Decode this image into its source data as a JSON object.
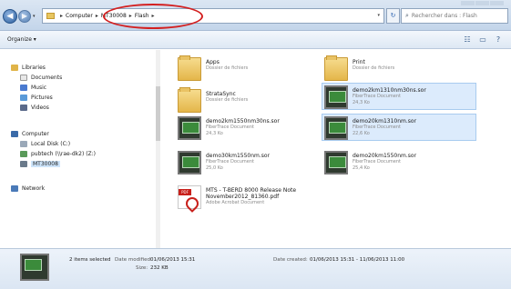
{
  "window": {
    "back_glyph": "◀",
    "forward_glyph": "▶"
  },
  "address_bar": {
    "crumbs": [
      "Computer",
      "MT30008",
      "Flash"
    ],
    "separator": "▸",
    "dropdown_glyph": "▾"
  },
  "refresh_glyph": "↻",
  "search": {
    "placeholder": "Rechercher dans : Flash",
    "icon": "magnifier-icon"
  },
  "toolbar": {
    "organize_label": "Organize ▾",
    "icons": [
      "view-options-icon",
      "preview-pane-icon",
      "help-icon"
    ]
  },
  "nav": {
    "items": [
      {
        "label": "Libraries",
        "icon": "libraries-icon",
        "color": "#e0b448"
      },
      {
        "label": "Documents",
        "icon": "documents-icon",
        "color": "#e8e8e8"
      },
      {
        "label": "Music",
        "icon": "music-icon",
        "color": "#4a7ad0"
      },
      {
        "label": "Pictures",
        "icon": "pictures-icon",
        "color": "#5a9ad8"
      },
      {
        "label": "Videos",
        "icon": "videos-icon",
        "color": "#5a6a8a"
      },
      {
        "label": "Computer",
        "icon": "computer-icon",
        "color": "#3a6aa8"
      },
      {
        "label": "Local Disk (C:)",
        "icon": "disk-icon",
        "color": "#9aa8b8"
      },
      {
        "label": "pubtech (\\\\rae-dk2) (Z:)",
        "icon": "network-drive-icon",
        "color": "#5a9a5a"
      },
      {
        "label": "MT30008",
        "icon": "device-icon",
        "color": "#6a7a8a"
      },
      {
        "label": "Network",
        "icon": "network-icon",
        "color": "#4a7ab8"
      }
    ]
  },
  "files": [
    {
      "name": "Apps",
      "type": "Dossier de fichiers",
      "size": "",
      "icon": "folder-icon",
      "selected": false
    },
    {
      "name": "Print",
      "type": "Dossier de fichiers",
      "size": "",
      "icon": "folder-icon",
      "selected": false
    },
    {
      "name": "StrataSync",
      "type": "Dossier de fichiers",
      "size": "",
      "icon": "folder-icon",
      "selected": false
    },
    {
      "name": "demo2km1310nm30ns.sor",
      "type": "FiberTrace Document",
      "size": "24,3 Ko",
      "icon": "sor-file-icon",
      "selected": true
    },
    {
      "name": "demo2km1550nm30ns.sor",
      "type": "FiberTrace Document",
      "size": "24,3 Ko",
      "icon": "sor-file-icon",
      "selected": false
    },
    {
      "name": "demo20km1310nm.sor",
      "type": "FiberTrace Document",
      "size": "22,6 Ko",
      "icon": "sor-file-icon",
      "selected": true
    },
    {
      "name": "demo30km1550nm.sor",
      "type": "FiberTrace Document",
      "size": "25,0 Ko",
      "icon": "sor-file-icon",
      "selected": false
    },
    {
      "name": "demo20km1550nm.sor",
      "type": "FiberTrace Document",
      "size": "25,4 Ko",
      "icon": "sor-file-icon",
      "selected": false
    },
    {
      "name": "MTS - T-BERD 8000 Release Note",
      "name2": "November2012_81360.pdf",
      "type": "Adobe Acrobat Document",
      "size": "",
      "icon": "pdf-file-icon",
      "selected": false
    }
  ],
  "details": {
    "selected_text": "2 items selected",
    "modified_label": "Date modified:",
    "modified_value": "01/06/2013 15:31",
    "size_label": "Size:",
    "size_value": "232 KB",
    "created_label": "Date created:",
    "created_value": "01/06/2013 15:31 - 11/06/2013 11:00"
  }
}
